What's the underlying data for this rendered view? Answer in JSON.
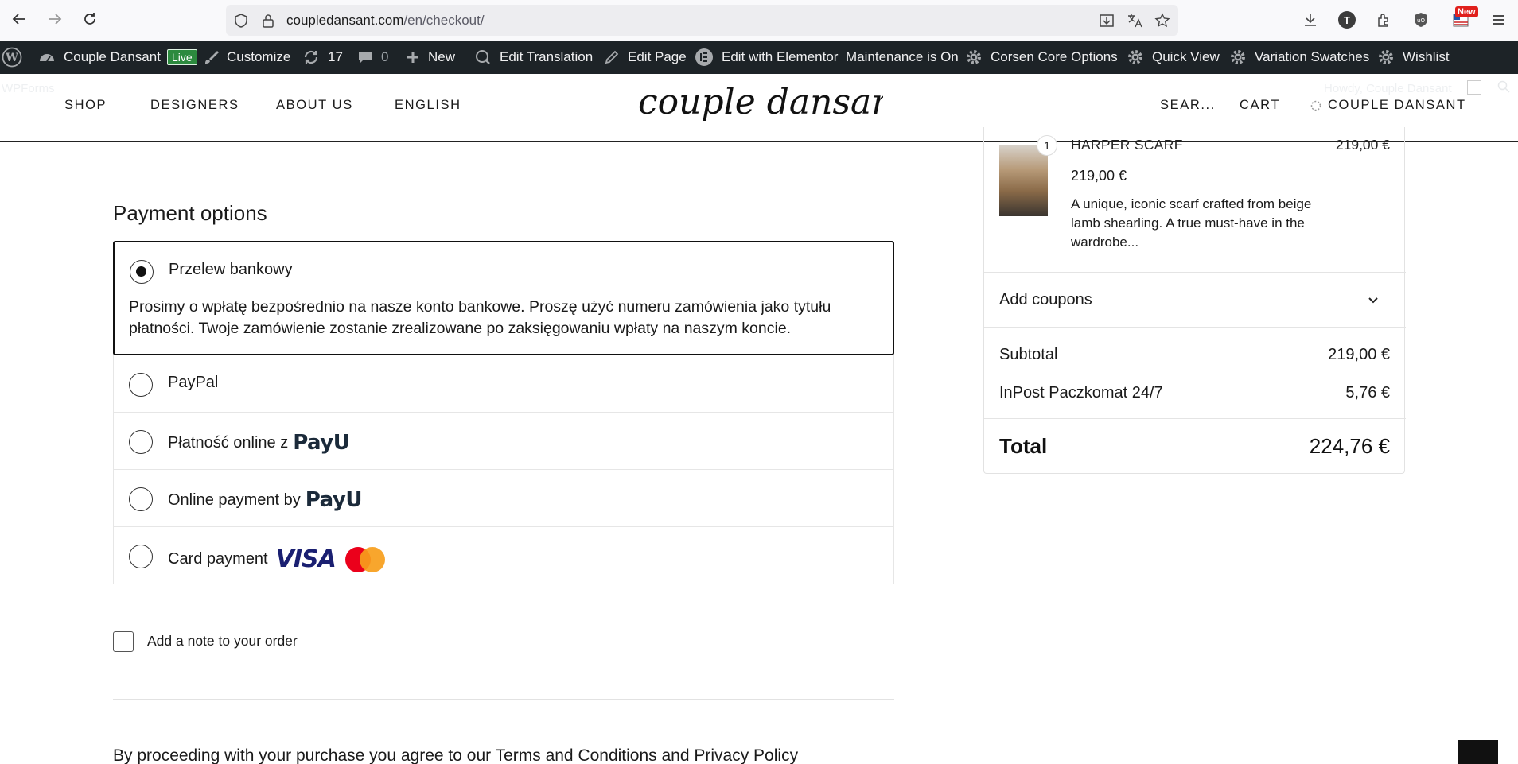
{
  "browser": {
    "url_host": "coupledansant.com",
    "url_path": "/en/checkout/",
    "new_badge": "New",
    "account_initial": "T"
  },
  "admin_bar": {
    "site_name": "Couple Dansant",
    "live_label": "Live",
    "customize": "Customize",
    "updates_count": "17",
    "comments_count": "0",
    "new": "New",
    "edit_translation": "Edit Translation",
    "edit_page": "Edit Page",
    "edit_elementor": "Edit with Elementor",
    "maintenance": "Maintenance is On",
    "corsen": "Corsen Core Options",
    "quick_view": "Quick View",
    "variation_swatches": "Variation Swatches",
    "wishlist": "Wishlist"
  },
  "header": {
    "menu": [
      "SHOP",
      "DESIGNERS",
      "ABOUT US",
      "ENGLISH"
    ],
    "logo_text": "couple dansant",
    "search": "SEAR...",
    "cart": "CART",
    "account": "COUPLE DANSANT",
    "ghost_left": "WPForms",
    "ghost_right": "Howdy, Couple Dansant"
  },
  "payment": {
    "title": "Payment options",
    "options": [
      {
        "label": "Przelew bankowy",
        "selected": true,
        "description": "Prosimy o wpłatę bezpośrednio na nasze konto bankowe. Proszę użyć numeru zamówienia jako tytułu płatności. Twoje zamówienie zostanie zrealizowane po zaksięgowaniu wpłaty na naszym koncie."
      },
      {
        "label": "PayPal",
        "selected": false
      },
      {
        "label": "Płatność online z",
        "selected": false,
        "logo": "PayU"
      },
      {
        "label": "Online payment by",
        "selected": false,
        "logo": "PayU"
      },
      {
        "label": "Card payment",
        "selected": false,
        "logo": "VISA"
      }
    ],
    "note_label": "Add a note to your order",
    "terms": "By proceeding with your purchase you agree to our Terms and Conditions and Privacy Policy"
  },
  "summary": {
    "product": {
      "qty": "1",
      "name": "HARPER SCARF",
      "line_total": "219,00 €",
      "price": "219,00 €",
      "description": "A unique, iconic scarf crafted from beige lamb shearling. A true must-have in the wardrobe..."
    },
    "coupons": "Add coupons",
    "subtotal_label": "Subtotal",
    "subtotal": "219,00 €",
    "shipping_label": "InPost Paczkomat 24/7",
    "shipping": "5,76 €",
    "total_label": "Total",
    "total": "224,76 €"
  },
  "colors": {
    "admin_bar": "#1d2327",
    "live_badge": "#2c8a3e",
    "visa_blue": "#1a1f71",
    "mc_red": "#eb001b",
    "mc_orange": "#f79e1b"
  }
}
